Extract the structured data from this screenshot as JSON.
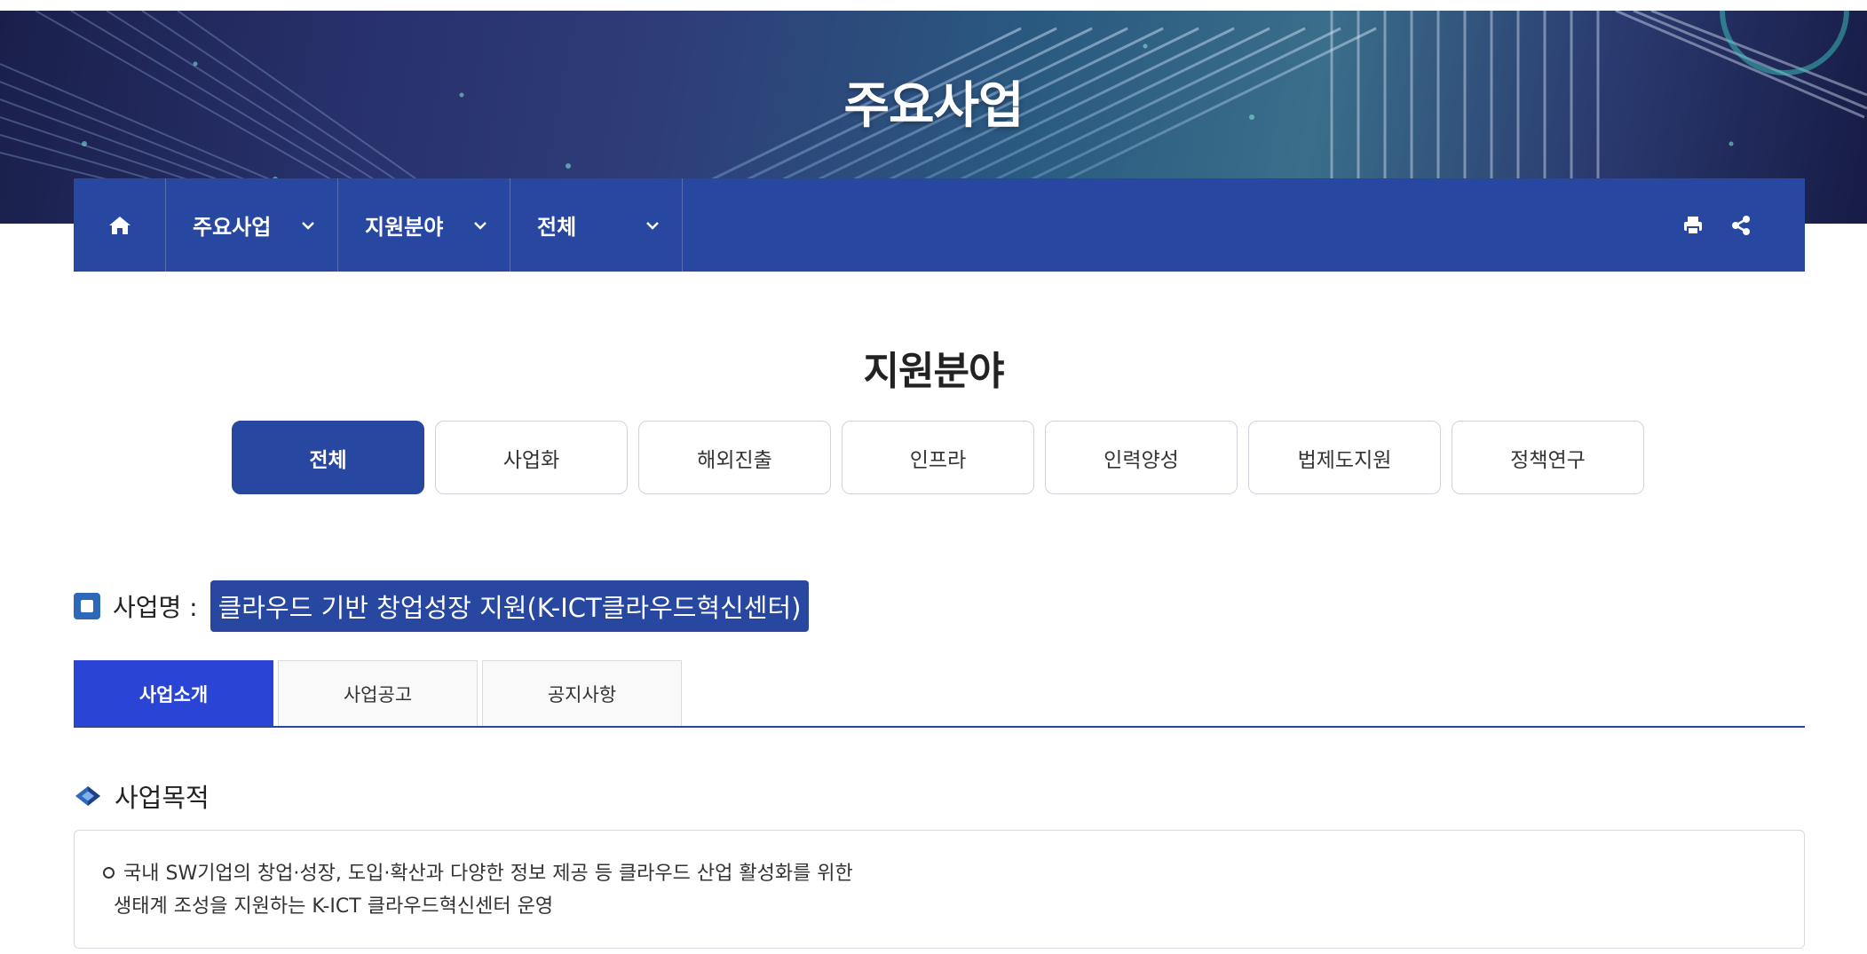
{
  "hero": {
    "title": "주요사업"
  },
  "nav": {
    "items": [
      {
        "label": "주요사업"
      },
      {
        "label": "지원분야"
      },
      {
        "label": "전체"
      }
    ]
  },
  "section": {
    "title": "지원분야"
  },
  "filters": [
    {
      "label": "전체",
      "active": true
    },
    {
      "label": "사업화"
    },
    {
      "label": "해외진출"
    },
    {
      "label": "인프라"
    },
    {
      "label": "인력양성"
    },
    {
      "label": "법제도지원"
    },
    {
      "label": "정책연구"
    }
  ],
  "project": {
    "label": "사업명 :",
    "name": "클라우드 기반 창업성장 지원(K-ICT클라우드혁신센터)"
  },
  "tabs": [
    {
      "label": "사업소개",
      "active": true
    },
    {
      "label": "사업공고"
    },
    {
      "label": "공지사항"
    }
  ],
  "purpose": {
    "title": "사업목적",
    "line1": "국내 SW기업의 창업·성장, 도입·확산과 다양한 정보 제공 등 클라우드 산업 활성화를 위한",
    "line2": "생태계 조성을 지원하는 K-ICT 클라우드혁신센터 운영"
  },
  "colors": {
    "primary": "#2847a0",
    "tab_active": "#2a45d6",
    "accent_icon": "#2e68b8"
  },
  "icons": {
    "home": "home-icon",
    "chevron": "chevron-down-icon",
    "print": "print-icon",
    "share": "share-icon",
    "project": "square-icon",
    "purpose": "diamond-icon"
  }
}
